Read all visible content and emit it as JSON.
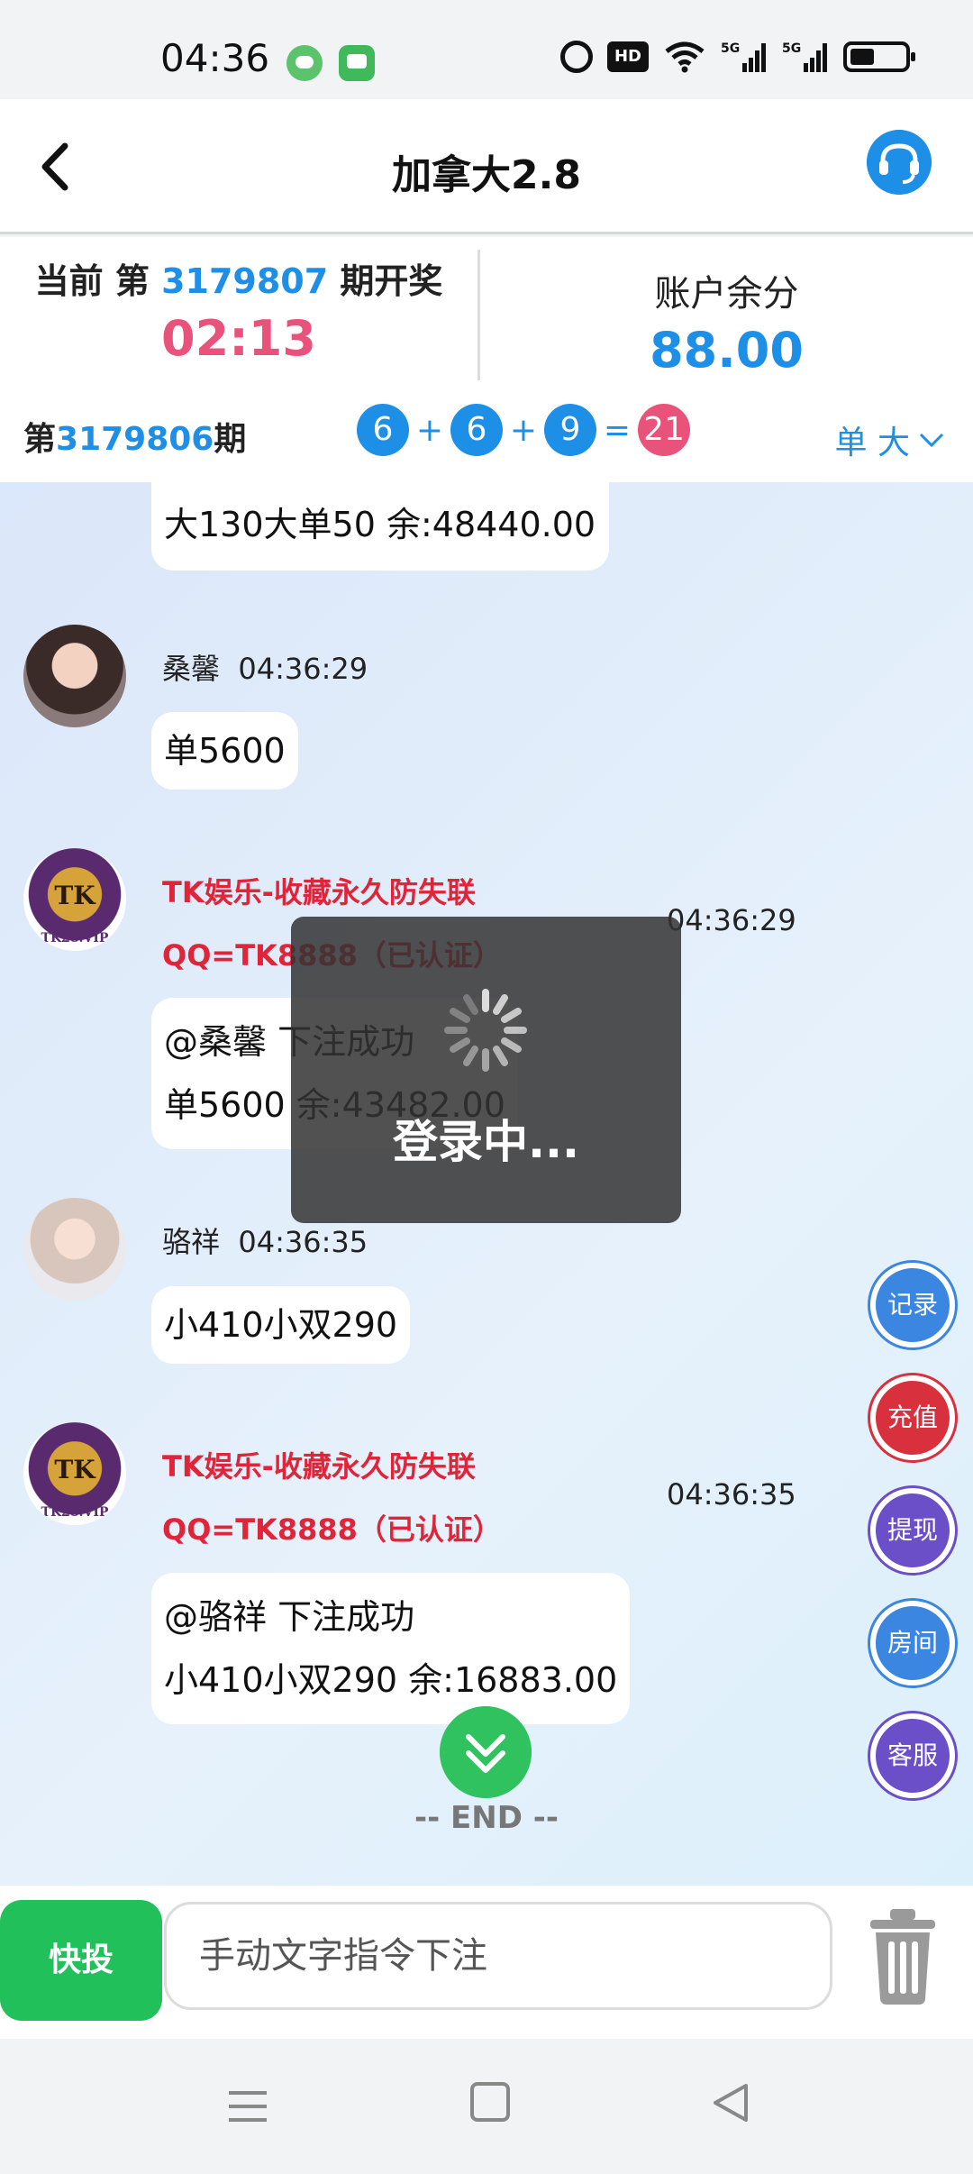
{
  "status_bar": {
    "time": "04:36",
    "icons": [
      "pop-notification-icon",
      "chat-app-icon",
      "alarm-icon",
      "hd-icon",
      "wifi-icon",
      "5g-signal-icon",
      "5g-signal-icon",
      "battery-icon"
    ],
    "hd_label": "HD"
  },
  "header": {
    "title": "加拿大2.8",
    "back_icon": "chevron-left-icon",
    "service_icon": "headset-icon"
  },
  "info": {
    "current_prefix": "当前 第",
    "current_period": "3179807",
    "current_suffix": "期开奖",
    "countdown": "02:13",
    "balance_label": "账户余分",
    "balance": "88.00"
  },
  "last_result": {
    "prefix": "第",
    "period": "3179806",
    "suffix": "期",
    "n1": "6",
    "plus1": "+",
    "n2": "6",
    "plus2": "+",
    "n3": "9",
    "eq": "=",
    "sum": "21",
    "tag": "单 大"
  },
  "messages": {
    "m0": {
      "line": "大130大单50 余:48440.00"
    },
    "m1": {
      "sender": "桑馨",
      "time": "04:36:29",
      "text": "单5600"
    },
    "m2": {
      "name": "TK娱乐-收藏永久防失联",
      "qq": "QQ=TK8888（已认证）",
      "time": "04:36:29",
      "line1": "@桑馨  下注成功",
      "line2": "单5600 余:43482.00",
      "logo_text": "TK",
      "logo_url": "TK28.VIP"
    },
    "m3": {
      "sender": "骆祥",
      "time": "04:36:35",
      "text": "小410小双290"
    },
    "m4": {
      "name": "TK娱乐-收藏永久防失联",
      "qq": "QQ=TK8888（已认证）",
      "time": "04:36:35",
      "line1": "@骆祥  下注成功",
      "line2": "小410小双290 余:16883.00",
      "logo_text": "TK",
      "logo_url": "TK28.VIP"
    }
  },
  "side_buttons": {
    "records": "记录",
    "recharge": "充值",
    "withdraw": "提现",
    "room": "房间",
    "service": "客服",
    "colors": {
      "records": "#3a86e0",
      "recharge": "#d9303e",
      "withdraw": "#6a4fc8",
      "room": "#3a86e0",
      "service": "#6a4fc8"
    }
  },
  "end_label": "-- END --",
  "loading": {
    "text": "登录中..."
  },
  "input_bar": {
    "quick_label": "快投",
    "placeholder": "手动文字指令下注",
    "value": ""
  },
  "colors": {
    "accent": "#1e8fe6",
    "countdown": "#e9527a",
    "admin": "#e0243a",
    "quick": "#22c05a"
  }
}
